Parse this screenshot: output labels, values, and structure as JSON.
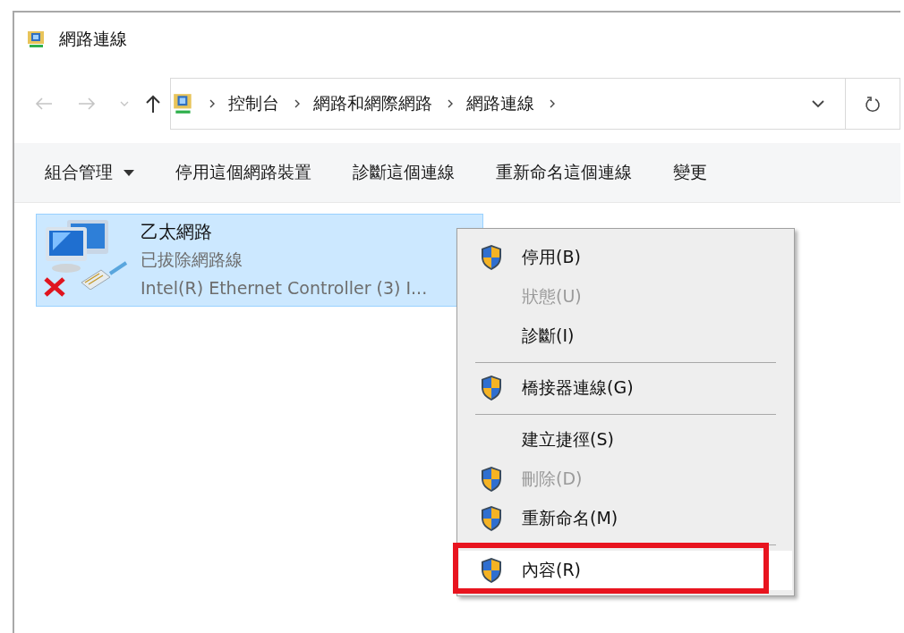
{
  "window": {
    "title": "網路連線"
  },
  "nav": {
    "back_disabled": true,
    "forward_disabled": true
  },
  "breadcrumb": [
    "控制台",
    "網路和網際網路",
    "網路連線"
  ],
  "commands": [
    {
      "label": "組合管理",
      "dropdown": true
    },
    {
      "label": "停用這個網路裝置",
      "dropdown": false
    },
    {
      "label": "診斷這個連線",
      "dropdown": false
    },
    {
      "label": "重新命名這個連線",
      "dropdown": false
    },
    {
      "label": "變更",
      "dropdown": false
    }
  ],
  "connection": {
    "name": "乙太網路",
    "status": "已拔除網路線",
    "device": "Intel(R) Ethernet Controller (3) I...",
    "disconnected": true,
    "selected": true
  },
  "context_menu": [
    {
      "kind": "item",
      "label": "停用(B)",
      "shield": true,
      "disabled": false,
      "selected": false,
      "annotated": false
    },
    {
      "kind": "item",
      "label": "狀態(U)",
      "shield": false,
      "disabled": true,
      "selected": false,
      "annotated": false
    },
    {
      "kind": "item",
      "label": "診斷(I)",
      "shield": false,
      "disabled": false,
      "selected": false,
      "annotated": false
    },
    {
      "kind": "separator"
    },
    {
      "kind": "item",
      "label": "橋接器連線(G)",
      "shield": true,
      "disabled": false,
      "selected": false,
      "annotated": false
    },
    {
      "kind": "separator"
    },
    {
      "kind": "item",
      "label": "建立捷徑(S)",
      "shield": false,
      "disabled": false,
      "selected": false,
      "annotated": false
    },
    {
      "kind": "item",
      "label": "刪除(D)",
      "shield": true,
      "disabled": true,
      "selected": false,
      "annotated": false
    },
    {
      "kind": "item",
      "label": "重新命名(M)",
      "shield": true,
      "disabled": false,
      "selected": false,
      "annotated": false
    },
    {
      "kind": "separator"
    },
    {
      "kind": "item",
      "label": "內容(R)",
      "shield": true,
      "disabled": false,
      "selected": true,
      "annotated": true
    }
  ]
}
